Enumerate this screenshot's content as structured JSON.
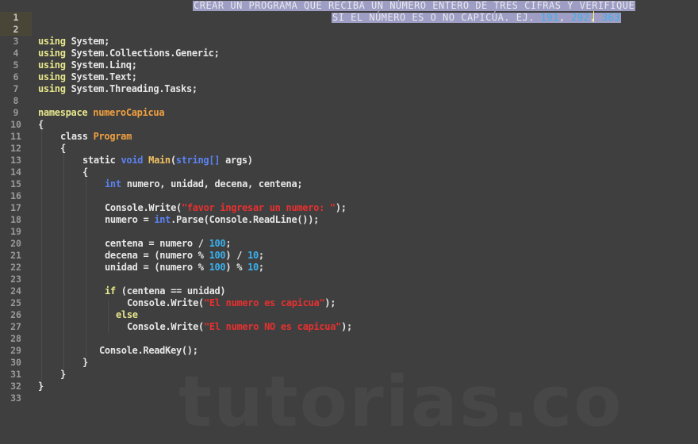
{
  "editor": {
    "theme_colors": {
      "background": "#3f3f3f",
      "keyword": "#e6e68c",
      "type_keyword": "#5c82f0",
      "class_name": "#f0a040",
      "method_name": "#f0c060",
      "string": "#e83030",
      "number": "#3ab0ee",
      "selection": "#9e9ec4"
    },
    "header_comment": {
      "line1": "CREAR UN PROGRAMA QUE RECIBA UN NÚMERO ENTERO DE TRES CIFRAS Y VERIFIQUE",
      "line2_text": "SI EL NÚMERO ES O NO CAPICÚA. EJ. ",
      "line2_examples": [
        "191",
        "292",
        "363"
      ],
      "sep": ", "
    },
    "line_numbers": [
      "1",
      "2",
      "3",
      "4",
      "5",
      "6",
      "7",
      "8",
      "9",
      "10",
      "11",
      "12",
      "13",
      "14",
      "15",
      "16",
      "17",
      "18",
      "19",
      "20",
      "21",
      "22",
      "23",
      "24",
      "25",
      "26",
      "27",
      "28",
      "29",
      "30",
      "31",
      "32",
      "33"
    ],
    "code": {
      "using_kw": "using",
      "usings": [
        "System;",
        "System.Collections.Generic;",
        "System.Linq;",
        "System.Text;",
        "System.Threading.Tasks;"
      ],
      "namespace_kw": "namespace",
      "namespace_name": "numeroCapicua",
      "open_brace": "{",
      "close_brace": "}",
      "class_kw": "class",
      "class_name": "Program",
      "static_kw": "static",
      "void_kw": "void",
      "main_name": "Main",
      "string_arr": "string[]",
      "args": " args)",
      "paren_open": "(",
      "int_kw": "int",
      "decl": " numero, unidad, decena, centena;",
      "console_write": "Console.Write(",
      "str_prompt": "\"favor ingresar un numero: \"",
      "end_call": ");",
      "numero_assign": "numero = ",
      "parse_rest": ".Parse(Console.ReadLine());",
      "centena_assign": "centena = numero / ",
      "decena_a": "decena = (numero % ",
      "decena_b": ") / ",
      "unidad_a": "unidad = (numero % ",
      "unidad_b": ") % ",
      "n100": "100",
      "n10": "10",
      "semicolon": ";",
      "if_kw": "if",
      "if_cond": " (centena == unidad)",
      "str_yes": "\"El numero es capicua\"",
      "else_kw": "else",
      "str_no": "\"El numero NO es capicua\"",
      "readkey": "Console.ReadKey();"
    }
  },
  "watermark": "tutorias.co"
}
